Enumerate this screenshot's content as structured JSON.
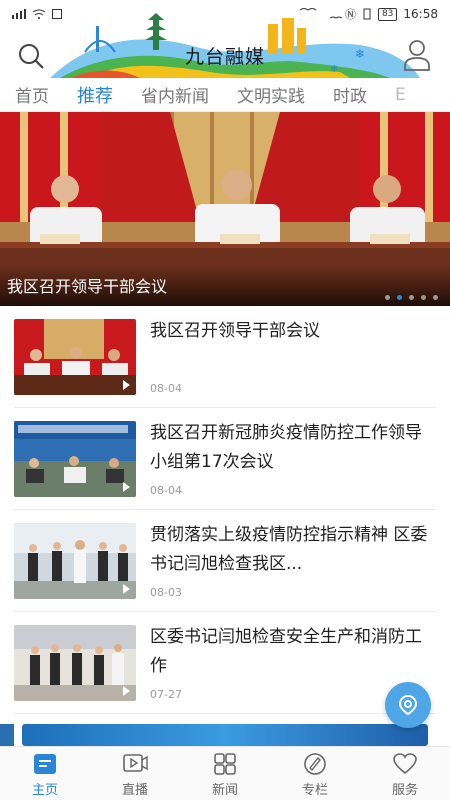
{
  "status": {
    "battery": "83",
    "time": "16:58"
  },
  "header": {
    "title": "九台融媒"
  },
  "tabs": [
    {
      "label": "首页"
    },
    {
      "label": "推荐"
    },
    {
      "label": "省内新闻"
    },
    {
      "label": "文明实践"
    },
    {
      "label": "时政"
    },
    {
      "label": "E"
    }
  ],
  "banner": {
    "title": "我区召开领导干部会议",
    "active_dot": 2,
    "dot_count": 5
  },
  "news": [
    {
      "title": "我区召开领导干部会议",
      "date": "08-04"
    },
    {
      "title": "我区召开新冠肺炎疫情防控工作领导小组第17次会议",
      "date": "08-04"
    },
    {
      "title": "贯彻落实上级疫情防控指示精神 区委书记闫旭检查我区...",
      "date": "08-03"
    },
    {
      "title": "区委书记闫旭检查安全生产和消防工作",
      "date": "07-27"
    }
  ],
  "bottom_nav": [
    {
      "label": "主页",
      "icon": "home-icon"
    },
    {
      "label": "直播",
      "icon": "live-icon"
    },
    {
      "label": "新闻",
      "icon": "news-grid-icon"
    },
    {
      "label": "专栏",
      "icon": "column-icon"
    },
    {
      "label": "服务",
      "icon": "service-heart-icon"
    }
  ],
  "colors": {
    "accent": "#2a86d8",
    "fab": "#4fa6e6"
  }
}
